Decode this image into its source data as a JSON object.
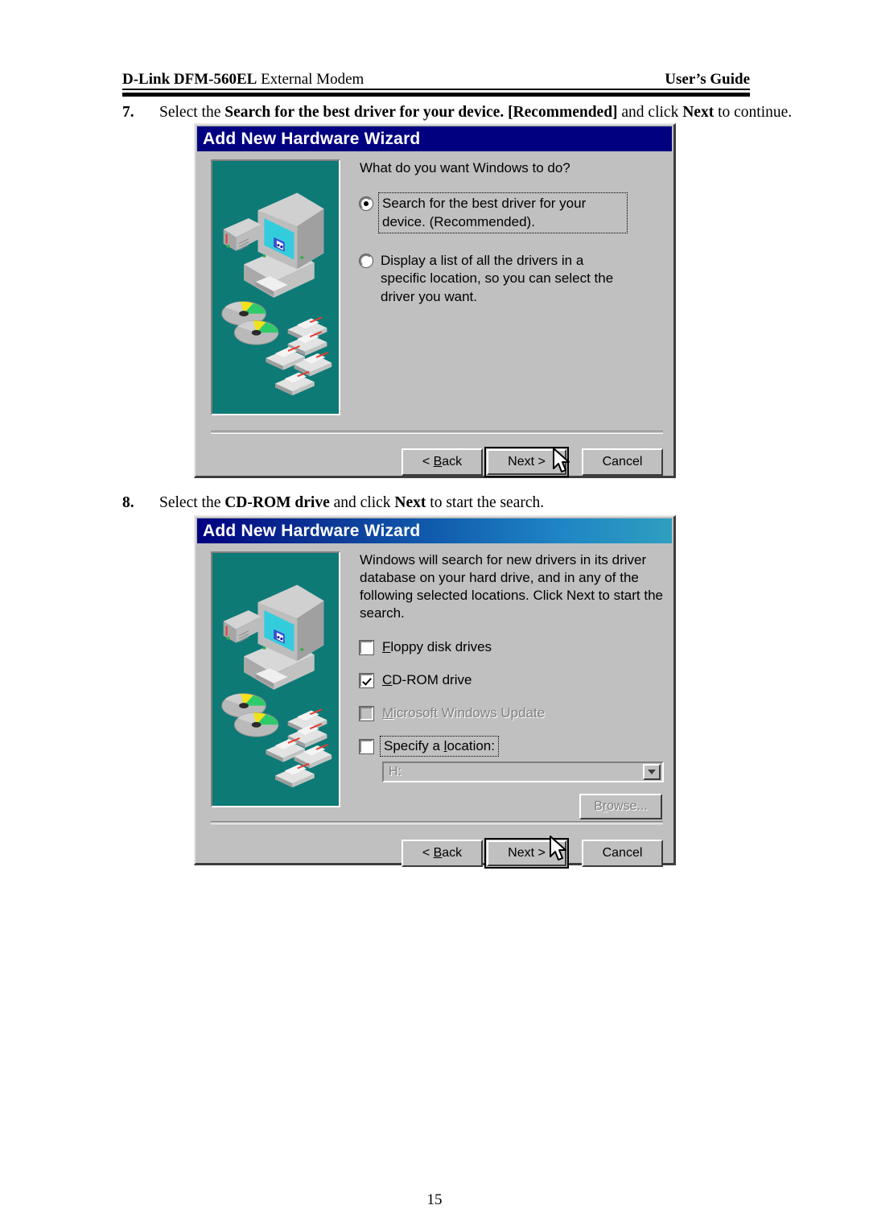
{
  "header": {
    "left_bold": "D-Link DFM-560EL",
    "left_rest": " External Modem",
    "right": "User’s Guide"
  },
  "steps": [
    {
      "number": "7.",
      "parts": [
        {
          "text": "Select the ",
          "bold": false
        },
        {
          "text": "Search for the best driver for your device. [Recommended]",
          "bold": true
        },
        {
          "text": " and click ",
          "bold": false
        },
        {
          "text": "Next",
          "bold": true
        },
        {
          "text": " to continue.",
          "bold": false
        }
      ]
    },
    {
      "number": "8.",
      "parts": [
        {
          "text": "Select the ",
          "bold": false
        },
        {
          "text": "CD-ROM drive",
          "bold": true
        },
        {
          "text": " and click ",
          "bold": false
        },
        {
          "text": "Next",
          "bold": true
        },
        {
          "text": " to start the search.",
          "bold": false
        }
      ]
    }
  ],
  "dialog1": {
    "title": "Add New Hardware Wizard",
    "prompt": "What do you want Windows to do?",
    "options": [
      {
        "label": "Search for the best driver for your device. (Recommended).",
        "selected": true,
        "focused": true
      },
      {
        "label": "Display a list of all the drivers in a specific location, so you can select the driver you want.",
        "selected": false,
        "focused": false
      }
    ],
    "buttons": {
      "back": "< Back",
      "back_mnemonic": "B",
      "next": "Next >",
      "cancel": "Cancel"
    }
  },
  "dialog2": {
    "title": "Add New Hardware Wizard",
    "prompt": "Windows will search for new drivers in its driver database on your hard drive, and in any of the following selected locations. Click Next to start the search.",
    "checkboxes": [
      {
        "label": "Floppy disk drives",
        "mnemonic": "F",
        "checked": false,
        "disabled": false,
        "focused": false
      },
      {
        "label": "CD-ROM drive",
        "mnemonic": "C",
        "checked": true,
        "disabled": false,
        "focused": false
      },
      {
        "label": "Microsoft Windows Update",
        "mnemonic": "M",
        "checked": false,
        "disabled": true,
        "focused": false
      },
      {
        "label": "Specify a location:",
        "mnemonic": "l",
        "checked": false,
        "disabled": false,
        "focused": true
      }
    ],
    "location_combo": {
      "value": "H:",
      "disabled": true
    },
    "browse_button": "Browse...",
    "buttons": {
      "back": "< Back",
      "back_mnemonic": "B",
      "next": "Next >",
      "cancel": "Cancel"
    }
  },
  "footer": {
    "page_number": "15"
  },
  "colors": {
    "titlebar_solid": "#000080",
    "titlebar_gradient_start": "#000080",
    "titlebar_gradient_end": "#2e9fc0",
    "dialog_face": "#c0c0c0",
    "illustration_teal": "#0d7a76",
    "screen_cyan": "#33ccdd",
    "disabled_text": "#808080"
  }
}
